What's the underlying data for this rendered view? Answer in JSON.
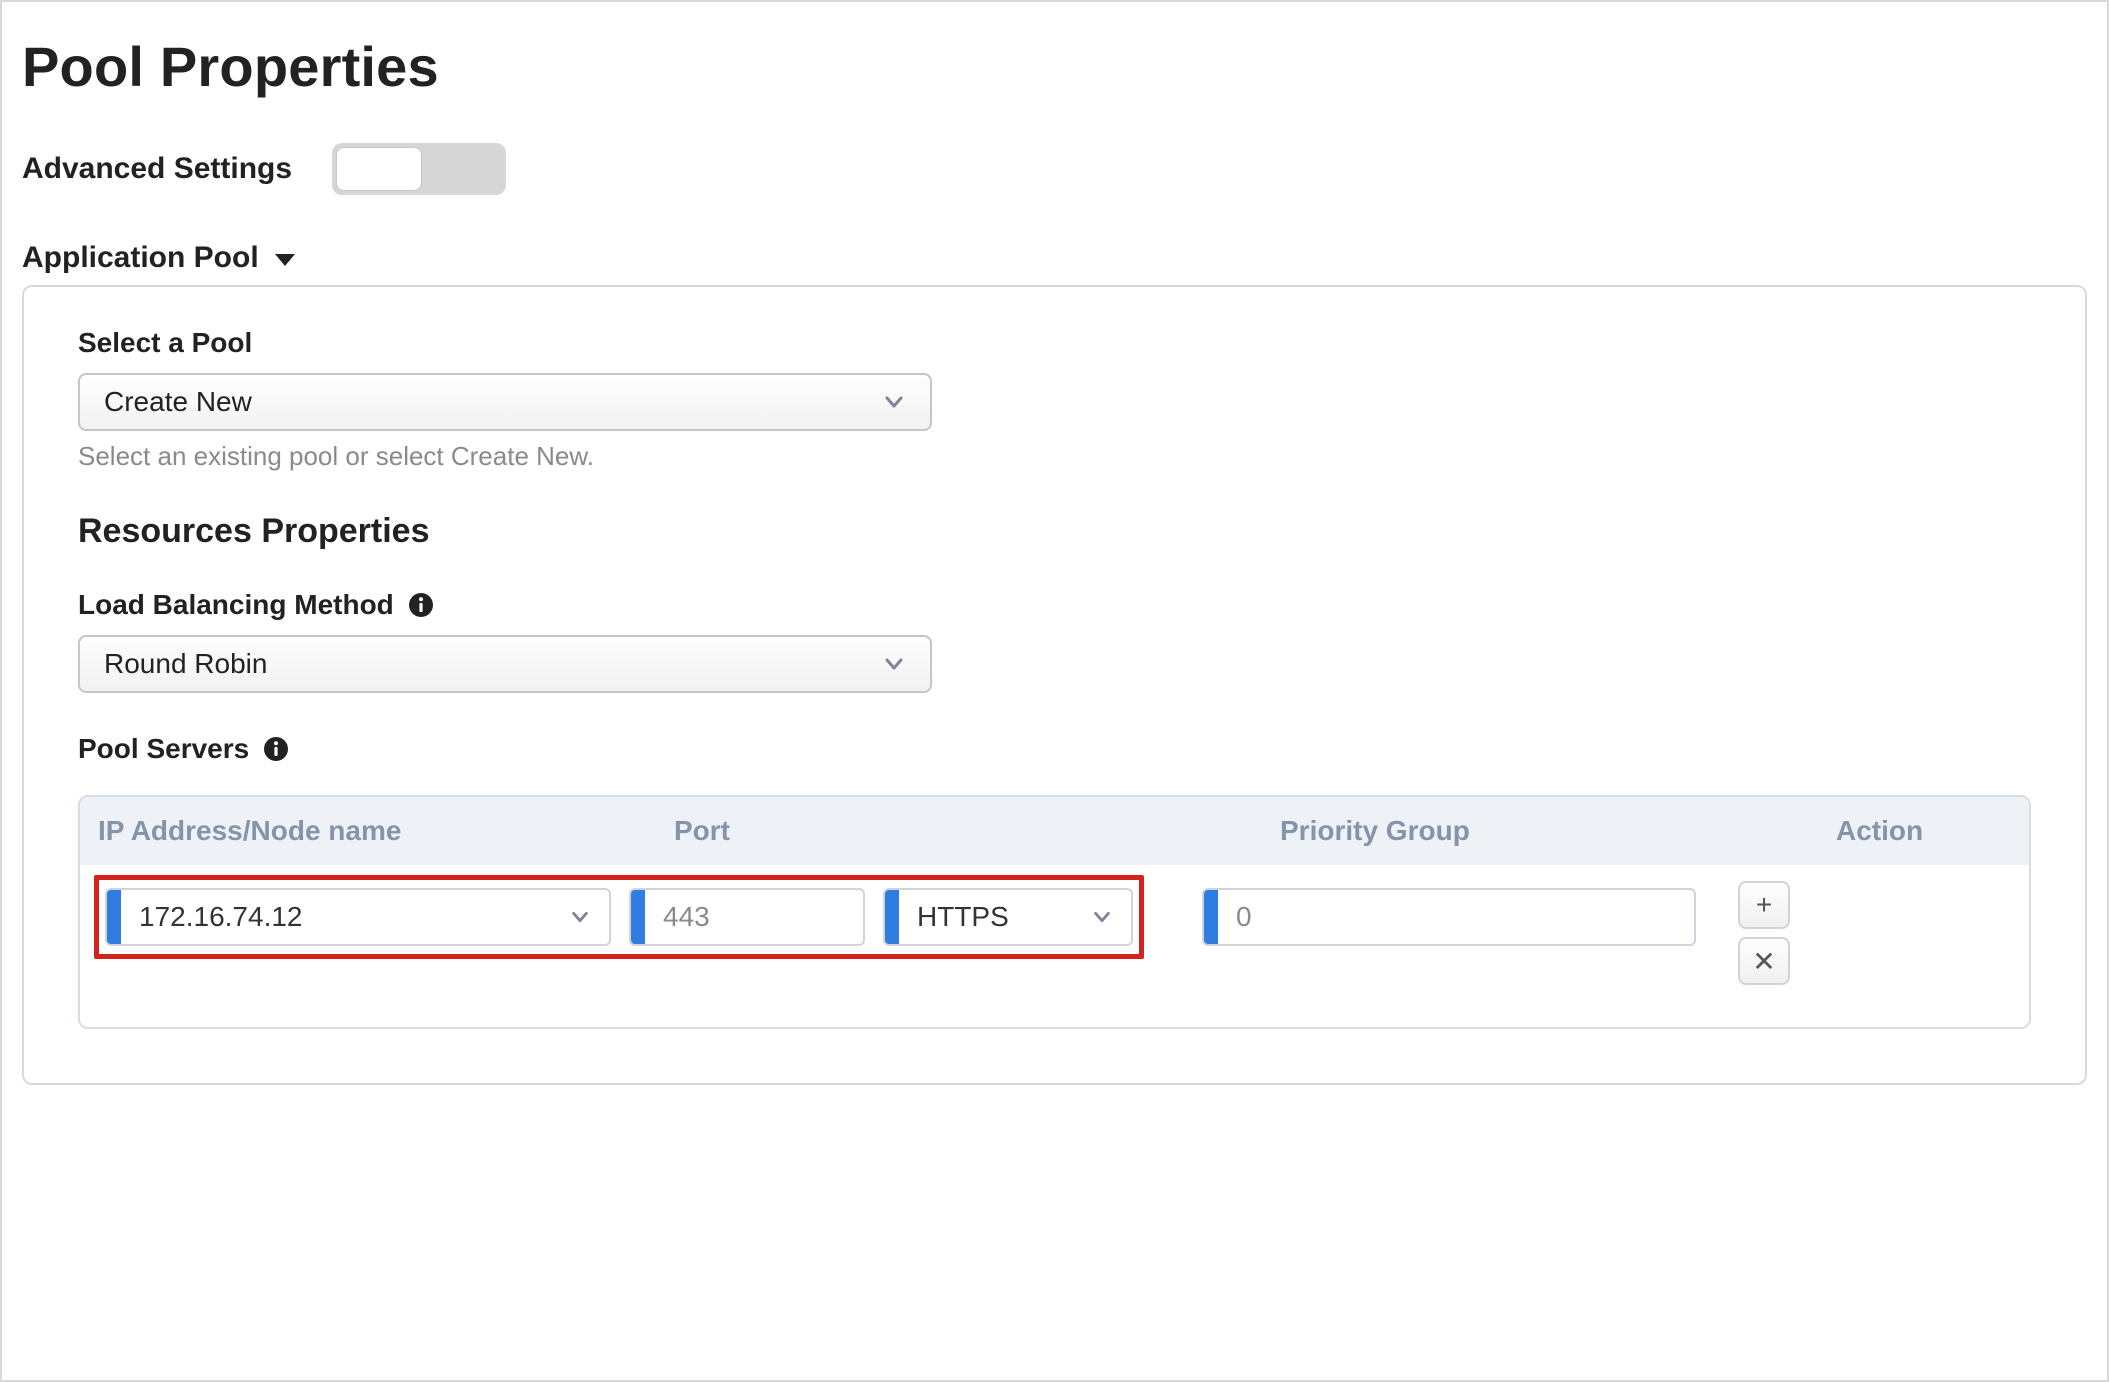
{
  "title": "Pool Properties",
  "advanced_settings_label": "Advanced Settings",
  "advanced_settings_on": false,
  "sections": {
    "application_pool": {
      "header": "Application Pool",
      "select_pool_label": "Select a Pool",
      "select_pool_value": "Create New",
      "select_pool_help": "Select an existing pool or select Create New.",
      "resources_title": "Resources Properties",
      "lbm_label": "Load Balancing Method",
      "lbm_value": "Round Robin",
      "pool_servers_label": "Pool Servers",
      "table": {
        "columns": {
          "ip": "IP Address/Node name",
          "port": "Port",
          "priority": "Priority Group",
          "action": "Action"
        },
        "row": {
          "ip": "172.16.74.12",
          "port": "443",
          "protocol": "HTTPS",
          "priority": "0"
        }
      }
    }
  },
  "icons": {
    "add": "+",
    "remove": "✕"
  }
}
